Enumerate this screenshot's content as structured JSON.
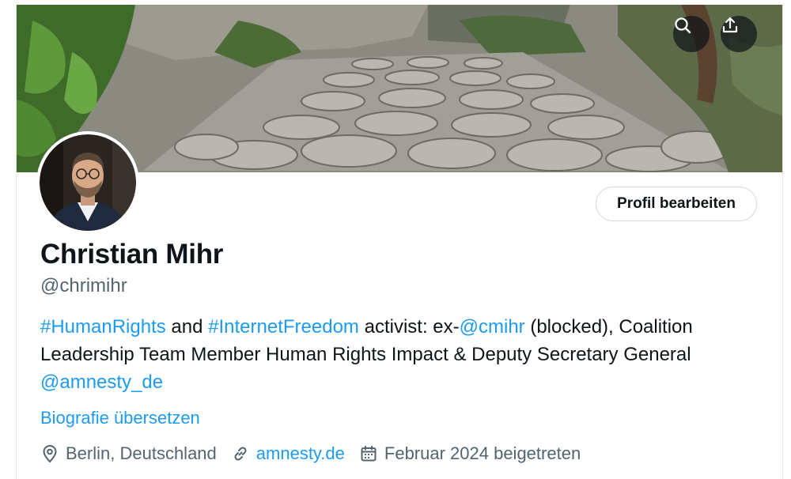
{
  "profile": {
    "name": "Christian Mihr",
    "handle": "@chrimihr",
    "edit_button_label": "Profil bearbeiten",
    "translate_bio_label": "Biografie übersetzen"
  },
  "bio": {
    "hashtag_human_rights": "#HumanRights",
    "text_and": " and ",
    "hashtag_internet_freedom": "#InternetFreedom",
    "text_activist": " activist: ex-",
    "mention_cmihr": "@cmihr",
    "text_rest": " (blocked), Coalition Leadership Team Member Human Rights Impact & Deputy Secretary General ",
    "mention_amnesty": "@amnesty_de"
  },
  "meta": {
    "location": "Berlin, Deutschland",
    "website": "amnesty.de",
    "joined": "Februar 2024 beigetreten"
  },
  "icons": {
    "search": "search-icon",
    "share": "share-icon",
    "location": "location-pin-icon",
    "link": "link-icon",
    "calendar": "calendar-icon"
  },
  "colors": {
    "accent_link": "#1d9bf0",
    "text_primary": "#0f1419",
    "text_secondary": "#536471",
    "button_border": "#cfd9de"
  }
}
